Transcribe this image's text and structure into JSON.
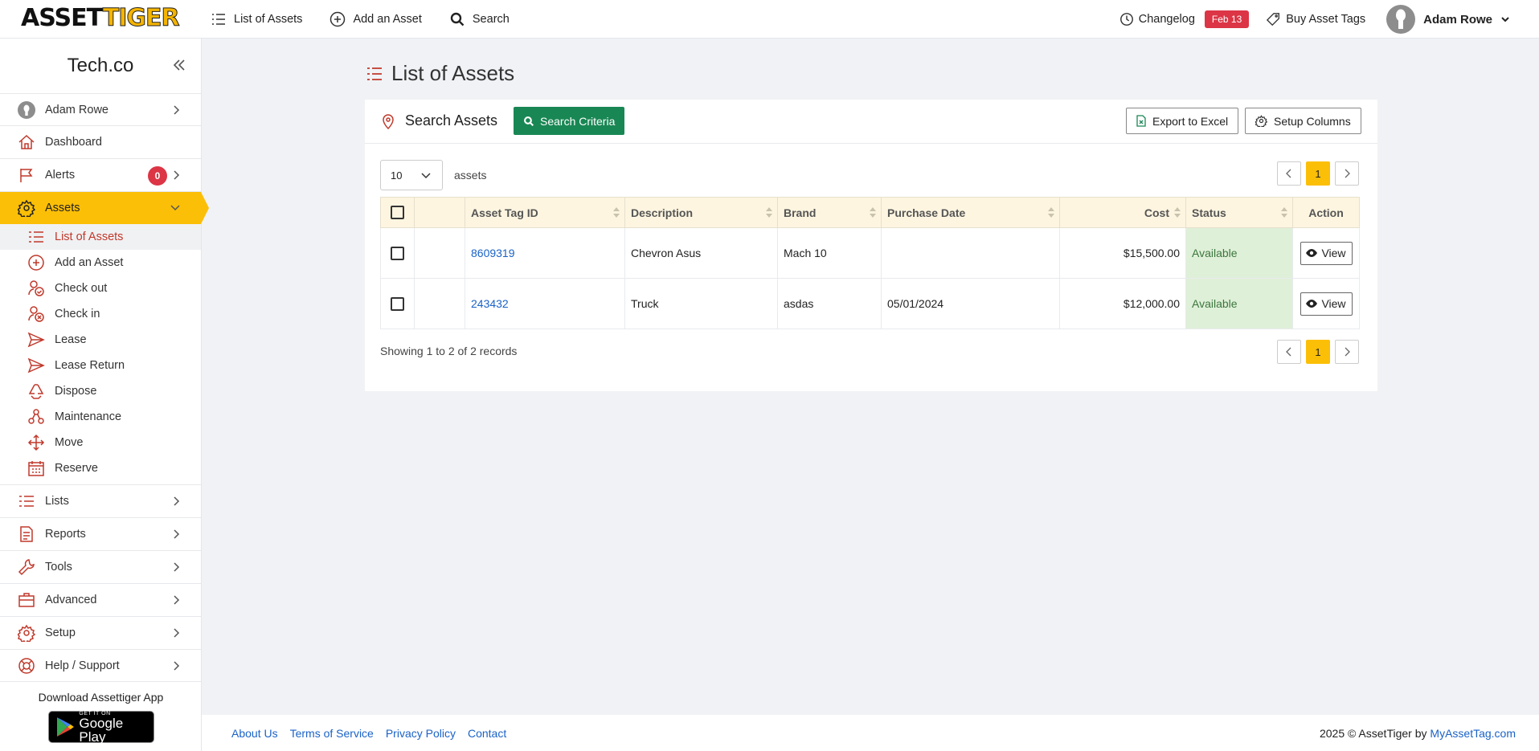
{
  "brand": {
    "logo_part1": "ASSET",
    "logo_part2": "TIGER"
  },
  "topnav": {
    "list_assets": "List of Assets",
    "add_asset": "Add an Asset",
    "search": "Search",
    "changelog": "Changelog",
    "changelog_badge": "Feb 13",
    "buy_tags": "Buy Asset Tags",
    "user": "Adam Rowe"
  },
  "sidebar": {
    "org": "Tech.co",
    "user": "Adam Rowe",
    "dashboard": "Dashboard",
    "alerts": "Alerts",
    "alerts_count": "0",
    "assets": "Assets",
    "sub": {
      "list": "List of Assets",
      "add": "Add an Asset",
      "checkout": "Check out",
      "checkin": "Check in",
      "lease": "Lease",
      "lease_return": "Lease Return",
      "dispose": "Dispose",
      "maintenance": "Maintenance",
      "move": "Move",
      "reserve": "Reserve"
    },
    "lists": "Lists",
    "reports": "Reports",
    "tools": "Tools",
    "advanced": "Advanced",
    "setup": "Setup",
    "help": "Help / Support",
    "download": "Download Assettiger App",
    "gplay_small": "GET IT ON",
    "gplay_big": "Google Play"
  },
  "main": {
    "title": "List of Assets",
    "search_assets": "Search Assets",
    "search_criteria": "Search Criteria",
    "export": "Export to Excel",
    "setup_columns": "Setup Columns",
    "page_size": "10",
    "assets_label": "assets",
    "current_page": "1",
    "columns": [
      "Asset Tag ID",
      "Description",
      "Brand",
      "Purchase Date",
      "Cost",
      "Status",
      "Action"
    ],
    "rows": [
      {
        "tag": "8609319",
        "description": "Chevron Asus",
        "brand": "Mach 10",
        "purchase_date": "",
        "cost": "$15,500.00",
        "status": "Available",
        "action": "View"
      },
      {
        "tag": "243432",
        "description": "Truck",
        "brand": "asdas",
        "purchase_date": "05/01/2024",
        "cost": "$12,000.00",
        "status": "Available",
        "action": "View"
      }
    ],
    "showing": "Showing 1 to 2 of 2 records"
  },
  "footer": {
    "about": "About Us",
    "terms": "Terms of Service",
    "privacy": "Privacy Policy",
    "contact": "Contact",
    "copyright": "2025 © AssetTiger by",
    "copyright_link": "MyAssetTag.com"
  },
  "colors": {
    "accent": "#fcbf07",
    "icon": "#c0392b",
    "green": "#198754",
    "link": "#1a62c7",
    "alert": "#dc3545"
  }
}
